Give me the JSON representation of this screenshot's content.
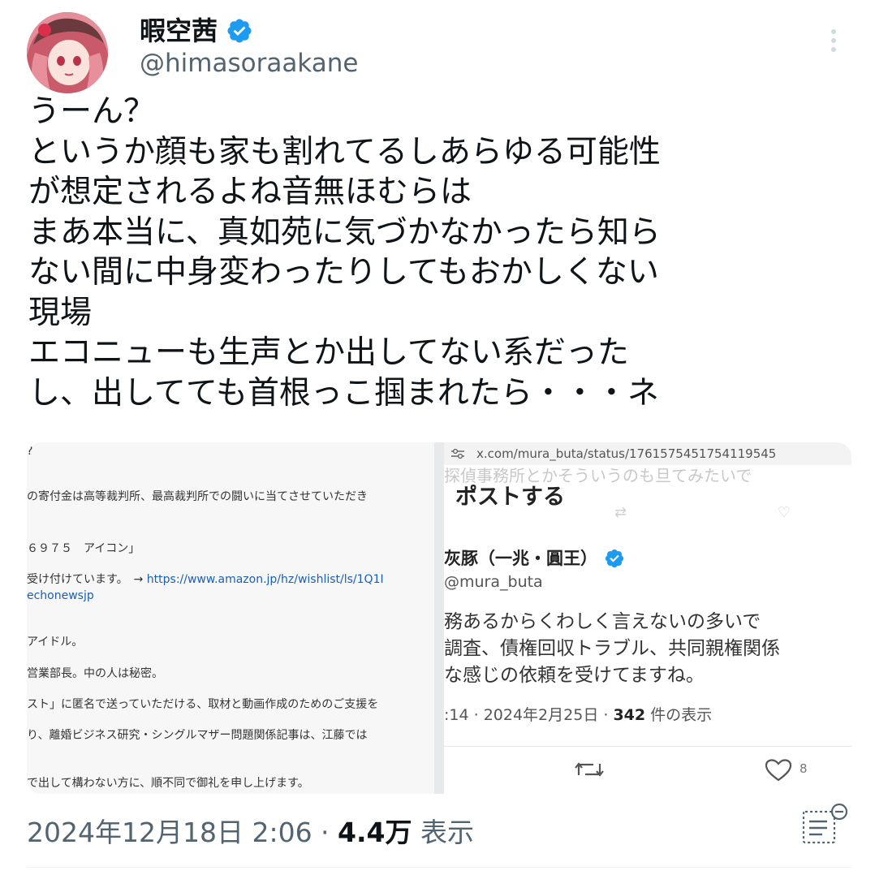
{
  "header": {
    "display_name": "暇空茜",
    "handle": "@himasoraakane",
    "verified_icon": "verified-badge-icon",
    "menu_icon": "more-vertical-icon"
  },
  "tweet": {
    "lines": [
      "うーん？",
      "というか顔も家も割れてるしあらゆる可能性",
      "が想定されるよね音無ほむらは",
      "まあ本当に、真如苑に気づかなかったら知ら",
      "ない間に中身変わったりしてもおかしくない",
      "現場",
      "エコニューも生声とか出してない系だった",
      "し、出してても首根っこ掴まれたら・・・ネ"
    ]
  },
  "media_left": {
    "lines": [
      "?",
      "の寄付金は高等裁判所、最高裁判所での闘いに当てさせていただき",
      "６９７５　アイコン」",
      "受け付けています。　→",
      "echonewsjp",
      "アイドル。",
      "営業部長。中の人は秘密。",
      "スト」に匿名で送っていただける、取材と動画作成のためのご支援を",
      "り、離婚ビジネス研究・シングルマザー問題関係記事は、江藤では",
      "で出して構わない方に、順不同で御礼を申し上げます。"
    ],
    "link": "https://www.amazon.jp/hz/wishlist/ls/1Q1I"
  },
  "media_right": {
    "url": "x.com/mura_buta/status/1761575451754119545",
    "ghost_text": "探偵事務所とかそういうのも旦てみたいで",
    "heading": "ポストする",
    "name": "灰豚（一兆・圓王）",
    "handle": "@mura_buta",
    "body_lines": [
      "務あるからくわしく言えないの多いで",
      "調査、債権回収トラブル、共同親権関係",
      "な感じの依頼を受けてますね。"
    ],
    "time": ":14 · 2024年2月25日 · ",
    "view_count": "342",
    "view_label": " 件の表示",
    "like_count": "8",
    "retweet_icon": "retweet-icon",
    "like_icon": "heart-icon"
  },
  "footer": {
    "timestamp": "2024年12月18日 2:06 · ",
    "views": "4.4万",
    "views_label": " 表示",
    "analytics_icon": "analytics-icon"
  },
  "colors": {
    "text": "#0f1419",
    "secondary": "#536471",
    "verified": "#1d9bf0"
  }
}
